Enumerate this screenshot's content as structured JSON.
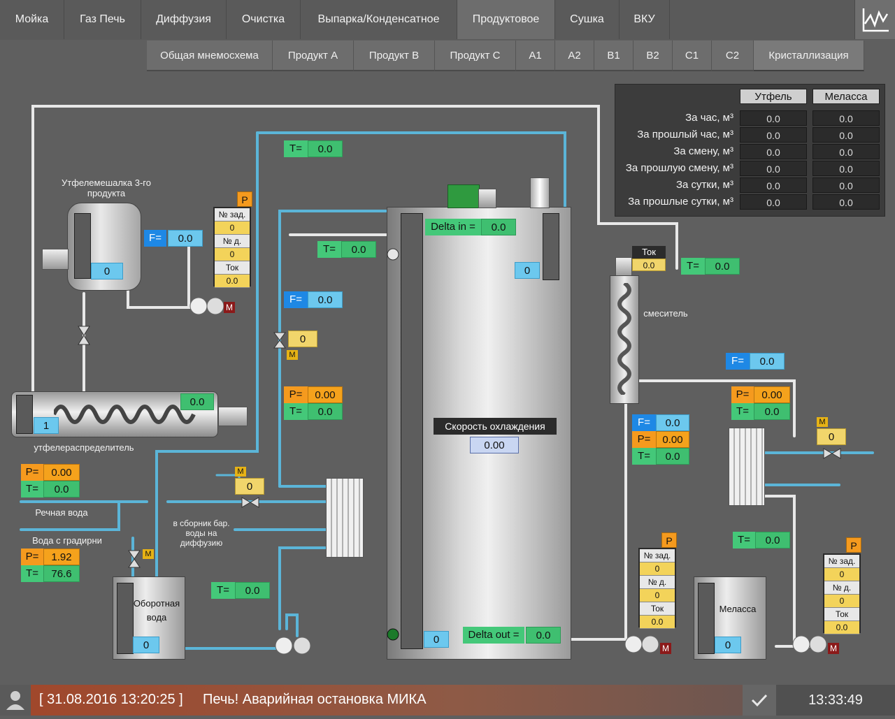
{
  "top_tabs": [
    "Мойка",
    "Газ Печь",
    "Диффузия",
    "Очистка",
    "Выпарка/Конденсатное",
    "Продуктовое",
    "Сушка",
    "ВКУ"
  ],
  "sub_tabs": [
    "Общая мнемосхема",
    "Продукт A",
    "Продукт B",
    "Продукт C",
    "A1",
    "A2",
    "B1",
    "B2",
    "C1",
    "C2",
    "Кристаллизация"
  ],
  "stats": {
    "col_utfel": "Утфель",
    "col_melassa": "Меласса",
    "rows": [
      {
        "label": "За час, м³",
        "utfel": "0.0",
        "melassa": "0.0"
      },
      {
        "label": "За прошлый час, м³",
        "utfel": "0.0",
        "melassa": "0.0"
      },
      {
        "label": "За смену, м³",
        "utfel": "0.0",
        "melassa": "0.0"
      },
      {
        "label": "За прошлую смену, м³",
        "utfel": "0.0",
        "melassa": "0.0"
      },
      {
        "label": "За сутки, м³",
        "utfel": "0.0",
        "melassa": "0.0"
      },
      {
        "label": "За прошлые сутки, м³",
        "utfel": "0.0",
        "melassa": "0.0"
      }
    ]
  },
  "labels": {
    "mixer3": "Утфелемешалка 3-го продукта",
    "distributor": "утфелераспределитель",
    "river": "Речная вода",
    "cooling_tower": "Вода с градирни",
    "to_collector": "в сборник бар. воды на диффузию",
    "circ_water": "Оборотная вода",
    "mixer": "смеситель",
    "molasses": "Меласса",
    "cooling_rate": "Скорость охлаждения",
    "delta_in": "Delta in =",
    "delta_out": "Delta out =",
    "tok": "Ток",
    "set_no": "№ зад.",
    "act_no": "№ д.",
    "p_eq": "P=",
    "t_eq": "T=",
    "f_eq": "F=",
    "p_tag": "P",
    "m_tag": "M"
  },
  "values": {
    "t_top": "0.0",
    "t_feed": "0.0",
    "f_mixer3": "0.0",
    "mixer3_level": "0",
    "pbox1": {
      "set": "0",
      "act": "0",
      "tok": "0.0"
    },
    "f_mid": "0.0",
    "valve_mid": "0",
    "p_mid": "0.00",
    "t_mid": "0.0",
    "dist_value": "0.0",
    "dist_level": "1",
    "p_river": "0.00",
    "t_river": "0.0",
    "valve_river": "0",
    "p_tower": "1.92",
    "t_tower": "76.6",
    "circ_level": "0",
    "t_bottom": "0.0",
    "delta_in": "0.0",
    "delta_out": "0.0",
    "tank_level_top": "0",
    "tank_level_bottom": "0",
    "cooling_rate": "0.00",
    "tok_mixer": "0.0",
    "t_mixer": "0.0",
    "f_right": "0.0",
    "p_right": "0.00",
    "t_right": "0.0",
    "valve_right": "0",
    "f_r2": "0.0",
    "p_r2": "0.00",
    "t_r2": "0.0",
    "pbox2": {
      "set": "0",
      "act": "0",
      "tok": "0.0"
    },
    "t_r3": "0.0",
    "pbox3": {
      "set": "0",
      "act": "0",
      "tok": "0.0"
    },
    "molasses_level": "0"
  },
  "status": {
    "datetime": "[ 31.08.2016  13:20:25 ]",
    "message": "Печь! Аварийная остановка МИКА",
    "clock": "13:33:49"
  },
  "icons": [
    "user-icon",
    "check-icon",
    "chart-icon"
  ]
}
